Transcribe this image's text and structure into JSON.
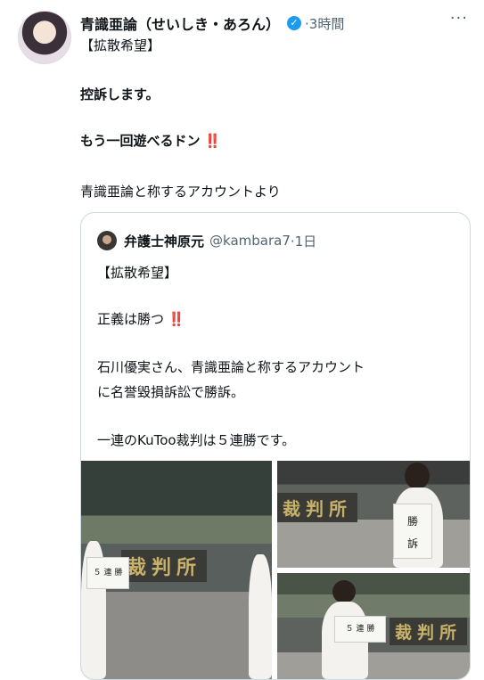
{
  "tweet": {
    "author_name": "青識亜論（せいしき・あろん）",
    "time": "·3時間",
    "more_icon": "more-icon",
    "lines": {
      "l1": "【拡散希望】",
      "l2": "控訴します。",
      "l3": "もう一回遊べるドン",
      "l3_emoji": "‼️",
      "l4": "青識亜論と称するアカウントより"
    }
  },
  "quote": {
    "author_name": "弁護士神原元",
    "handle": "@kambara7",
    "time": "·1日",
    "lines": {
      "l1": "【拡散希望】",
      "l2": "正義は勝つ",
      "l2_emoji": "‼️",
      "l3": "石川優実さん、青識亜論と称するアカウント",
      "l4": "に名誉毀損訴訟で勝訴。",
      "l5": "一連のKuToo裁判は５連勝です。"
    }
  },
  "photos": {
    "plate_text": "裁判所",
    "paper_small_a": "５ 連 勝",
    "paper_big_b1": "勝",
    "paper_big_b2": "訴",
    "paper_small_c": "５ 連 勝"
  },
  "colors": {
    "accent": "#1d9bf0",
    "secondary_text": "#536471",
    "border": "#cfd9de"
  }
}
